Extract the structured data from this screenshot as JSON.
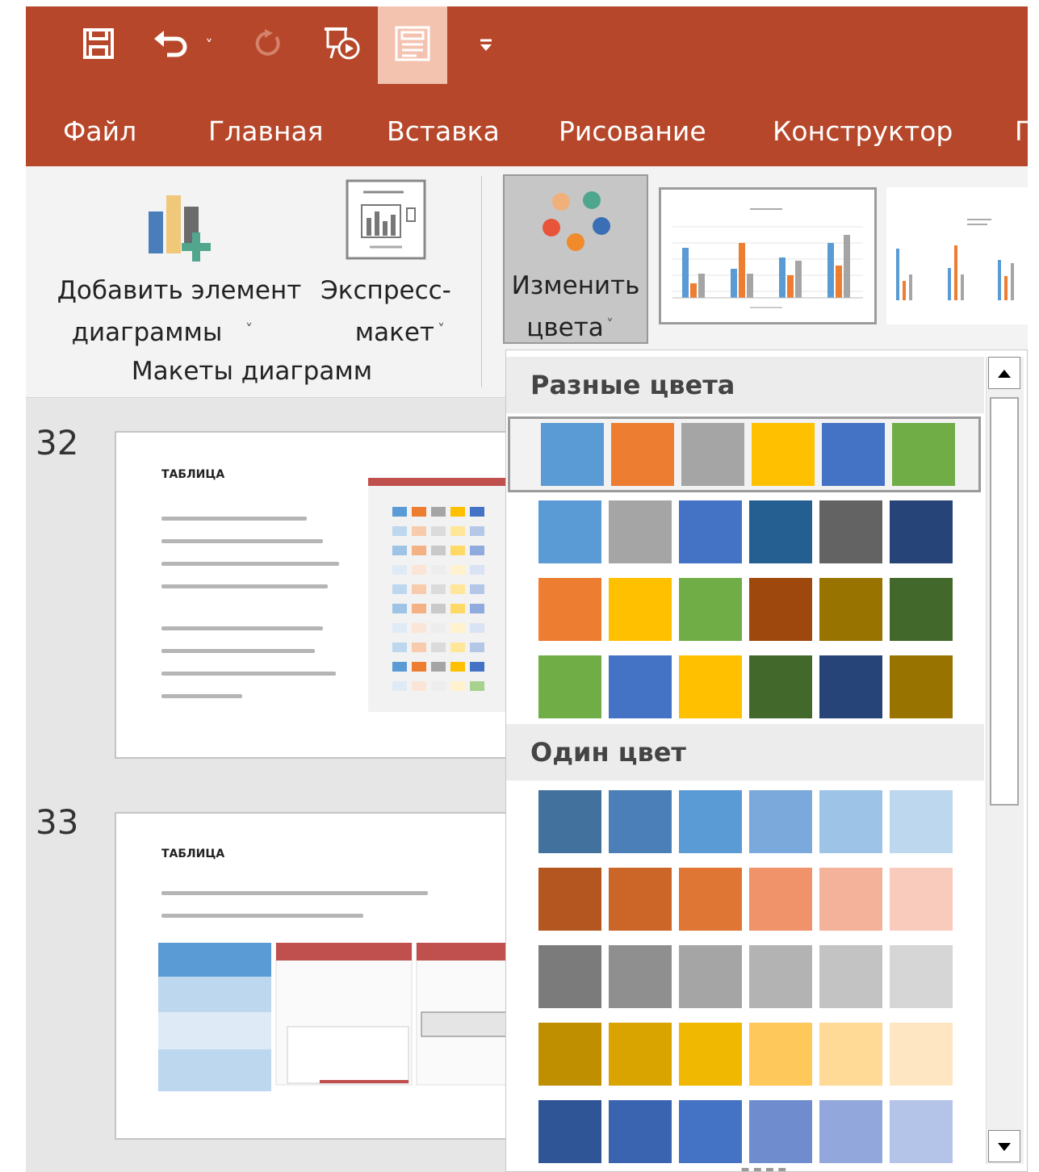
{
  "titlebar": {
    "qat": [
      {
        "icon": "save-icon"
      },
      {
        "icon": "undo-icon"
      },
      {
        "icon": "undo-dropdown-icon"
      },
      {
        "icon": "redo-icon"
      },
      {
        "icon": "present-from-start-icon"
      },
      {
        "icon": "slide-sorter-icon",
        "active": true
      },
      {
        "icon": "customize-qat-icon"
      }
    ]
  },
  "tabs": [
    {
      "label": "Файл"
    },
    {
      "label": "Главная"
    },
    {
      "label": "Вставка"
    },
    {
      "label": "Рисование"
    },
    {
      "label": "Конструктор"
    },
    {
      "label": "П"
    }
  ],
  "ribbon": {
    "add_element_line1": "Добавить элемент",
    "add_element_line2": "диаграммы",
    "express_line1": "Экспресс-",
    "express_line2": "макет",
    "group_label": "Макеты диаграмм",
    "change_colors_line1": "Изменить",
    "change_colors_line2": "цвета",
    "dropdown_arrow": "˅"
  },
  "slides": [
    {
      "number": "32",
      "title": "ТАБЛИЦА"
    },
    {
      "number": "33",
      "title": "ТАБЛИЦА"
    }
  ],
  "dropdown": {
    "colorful_title": "Разные цвета",
    "mono_title": "Один цвет",
    "colorful_rows": [
      [
        "#5b9bd5",
        "#ed7d31",
        "#a5a5a5",
        "#ffc000",
        "#4472c4",
        "#70ad47"
      ],
      [
        "#5b9bd5",
        "#a5a5a5",
        "#4472c4",
        "#255e91",
        "#636363",
        "#264478"
      ],
      [
        "#ed7d31",
        "#ffc000",
        "#70ad47",
        "#9e480e",
        "#997300",
        "#43682b"
      ],
      [
        "#70ad47",
        "#4472c4",
        "#ffc000",
        "#43682b",
        "#264478",
        "#997300"
      ]
    ],
    "mono_rows": [
      [
        "#41719c",
        "#4a80b7",
        "#5b9bd5",
        "#7ca9dc",
        "#9dc3e6",
        "#bdd7ee"
      ],
      [
        "#b3561f",
        "#cc6528",
        "#e07633",
        "#f0936b",
        "#f4b29b",
        "#f8cbbd"
      ],
      [
        "#7b7b7b",
        "#8f8f8f",
        "#a5a5a5",
        "#b3b3b3",
        "#c3c3c3",
        "#d6d6d6"
      ],
      [
        "#bf8f00",
        "#d9a300",
        "#f0b800",
        "#ffc85a",
        "#ffd996",
        "#ffe6c3"
      ],
      [
        "#2f5597",
        "#3a63b0",
        "#4472c4",
        "#6f8ccf",
        "#92a8dc",
        "#b4c3e8"
      ]
    ]
  },
  "colors": {
    "accent": "#b7472a",
    "ribbon_bg": "#f3f3f3",
    "active_qat": "#f4c3b0"
  }
}
